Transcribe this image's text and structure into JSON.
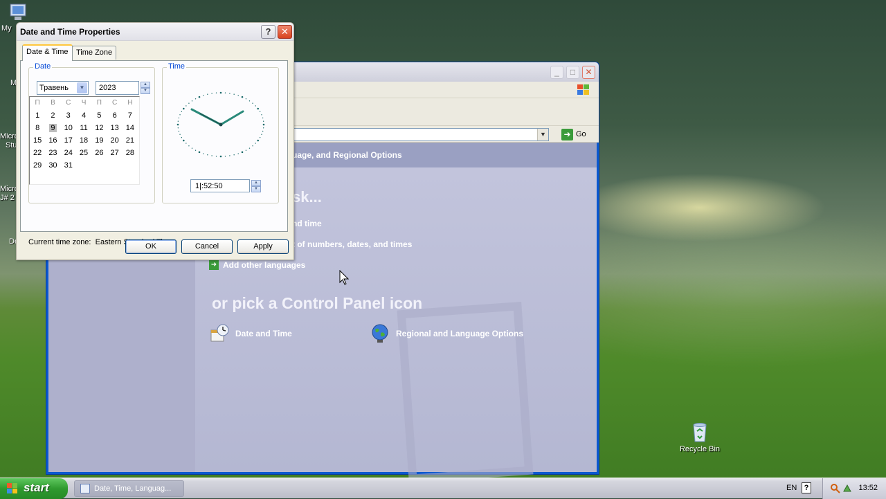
{
  "desktop": {
    "icons": [
      {
        "label": "My"
      },
      {
        "label": "M"
      },
      {
        "label": "Micro"
      },
      {
        "label": "Stu"
      },
      {
        "label": "Micro"
      },
      {
        "label": "J# 2"
      },
      {
        "label": "De"
      }
    ],
    "recycle_bin": "Recycle Bin"
  },
  "control_panel": {
    "go_label": "Go",
    "heading_band": "uage, and Regional Options",
    "pick_task_partial": "sk...",
    "tasks": [
      "nd time",
      "t of numbers, dates, and times",
      "Add other languages"
    ],
    "pick_icon_heading": "or pick a Control Panel icon",
    "items": [
      {
        "label": "Date and Time",
        "icon": "date-time-icon"
      },
      {
        "label": "Regional and Language Options",
        "icon": "globe-icon"
      }
    ]
  },
  "dialog": {
    "title": "Date and Time Properties",
    "help_glyph": "?",
    "close_glyph": "✕",
    "tabs": [
      {
        "label": "Date & Time",
        "active": true
      },
      {
        "label": "Time Zone",
        "active": false
      }
    ],
    "date_group": "Date",
    "time_group": "Time",
    "month": "Травень",
    "year": "2023",
    "weekday_headers": [
      "П",
      "В",
      "С",
      "Ч",
      "П",
      "С",
      "Н"
    ],
    "calendar_rows": [
      [
        "1",
        "2",
        "3",
        "4",
        "5",
        "6",
        "7"
      ],
      [
        "8",
        "9",
        "10",
        "11",
        "12",
        "13",
        "14"
      ],
      [
        "15",
        "16",
        "17",
        "18",
        "19",
        "20",
        "21"
      ],
      [
        "22",
        "23",
        "24",
        "25",
        "26",
        "27",
        "28"
      ],
      [
        "29",
        "30",
        "31",
        "",
        "",
        "",
        ""
      ]
    ],
    "selected_day": "9",
    "time_value": "1|:52:50",
    "timezone_label": "Current time zone:",
    "timezone_value": "Eastern Standard Time",
    "buttons": {
      "ok": "OK",
      "cancel": "Cancel",
      "apply": "Apply"
    }
  },
  "taskbar": {
    "start_label": "start",
    "task_button": "Date, Time, Languag...",
    "language": "EN",
    "help_glyph": "?",
    "clock": "13:52"
  },
  "colors": {
    "dialog_bg": "#f1efe2",
    "group_label": "#0046d5",
    "clock_hands": "#2a8a7a"
  }
}
